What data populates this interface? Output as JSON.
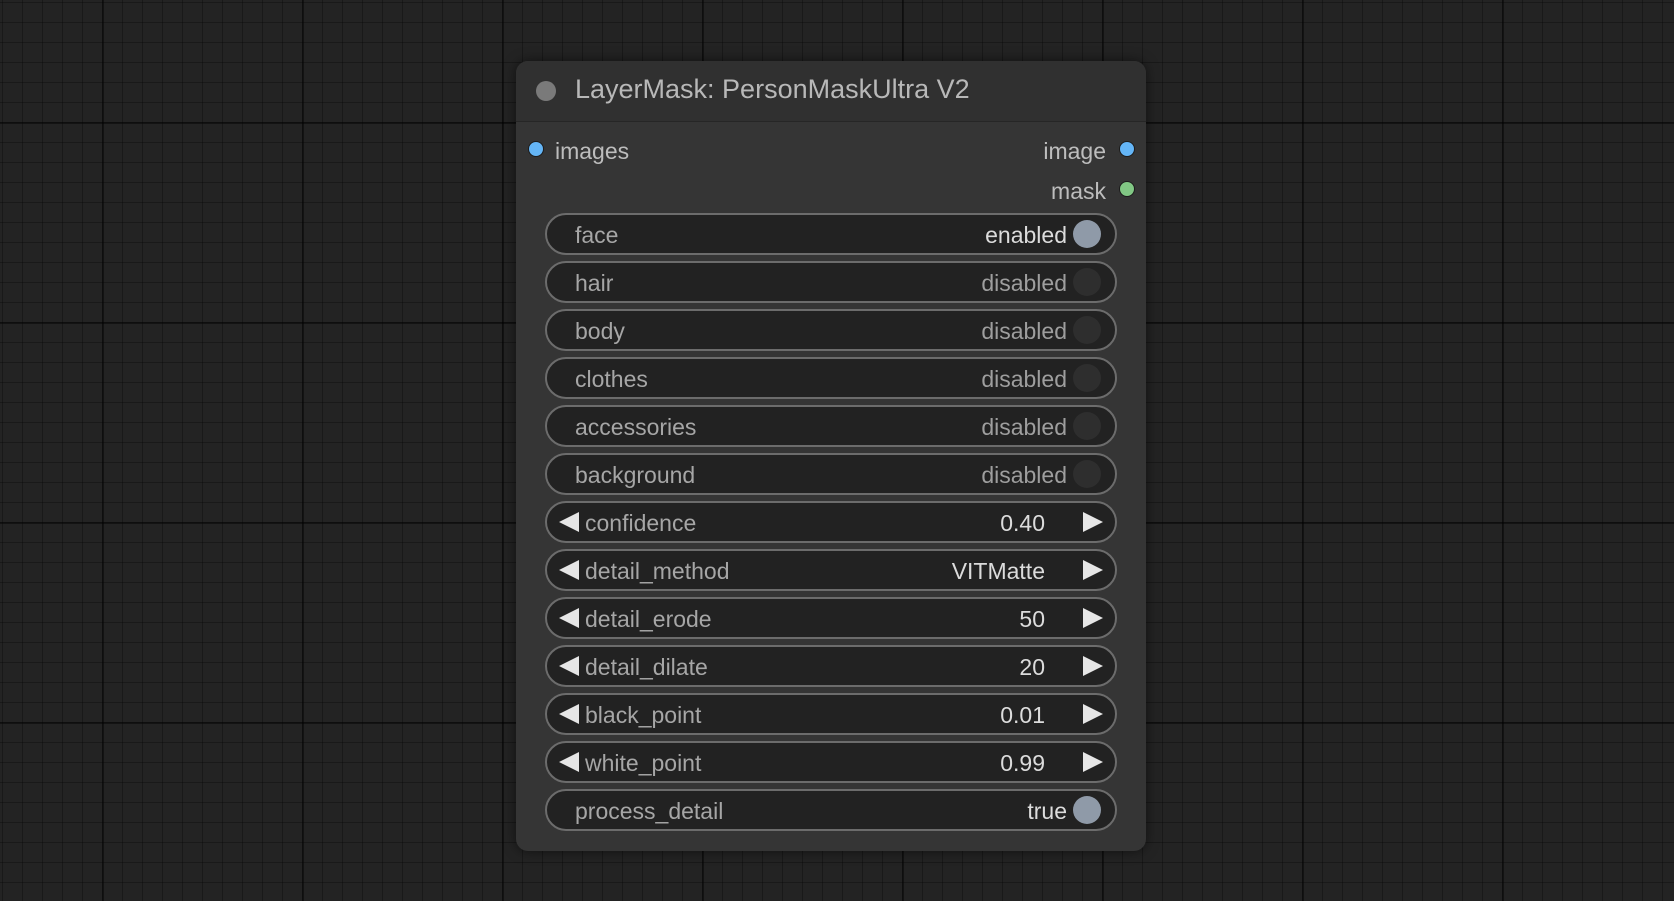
{
  "node": {
    "title": "LayerMask: PersonMaskUltra V2",
    "inputs": [
      {
        "label": "images",
        "color": "#64b5f6"
      }
    ],
    "outputs": [
      {
        "label": "image",
        "color": "#64b5f6"
      },
      {
        "label": "mask",
        "color": "#81c784"
      }
    ],
    "toggles": [
      {
        "label": "face",
        "value": "enabled"
      },
      {
        "label": "hair",
        "value": "disabled"
      },
      {
        "label": "body",
        "value": "disabled"
      },
      {
        "label": "clothes",
        "value": "disabled"
      },
      {
        "label": "accessories",
        "value": "disabled"
      },
      {
        "label": "background",
        "value": "disabled"
      }
    ],
    "numbers": [
      {
        "label": "confidence",
        "value": "0.40"
      },
      {
        "label": "detail_method",
        "value": "VITMatte"
      },
      {
        "label": "detail_erode",
        "value": "50"
      },
      {
        "label": "detail_dilate",
        "value": "20"
      },
      {
        "label": "black_point",
        "value": "0.01"
      },
      {
        "label": "white_point",
        "value": "0.99"
      }
    ],
    "process_detail": {
      "label": "process_detail",
      "value": "true"
    }
  }
}
